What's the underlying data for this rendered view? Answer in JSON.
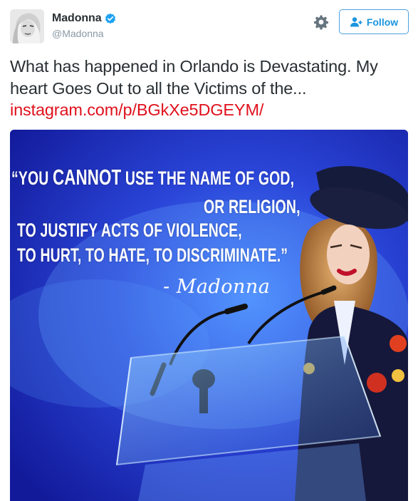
{
  "user": {
    "display_name": "Madonna",
    "handle": "@Madonna",
    "avatar_icon": "profile-photo",
    "verified_icon": "verified-badge-icon"
  },
  "actions": {
    "settings_icon": "gear-icon",
    "follow_label": "Follow",
    "follow_icon": "add-user-icon"
  },
  "tweet": {
    "text": "What has happened in Orlando is Devastating. My heart Goes Out to all the Victims of the...",
    "link_text": "instagram.com/p/BGkXe5DGEYM/"
  },
  "media": {
    "quote_line1_a": "“YOU ",
    "quote_line1_b": "CANNOT",
    "quote_line1_c": " USE THE NAME OF GOD,",
    "quote_line2": "OR RELIGION,",
    "quote_line3": "TO JUSTIFY ACTS OF VIOLENCE,",
    "quote_line4": "TO HURT, TO HATE, TO DISCRIMINATE.”",
    "attribution": "- Madonna"
  },
  "colors": {
    "link": "#e0101c",
    "follow_blue": "#1b95e0",
    "verified_blue": "#1da1f2",
    "text": "#292f33",
    "muted": "#8899a6",
    "media_bg": "#1620a8"
  }
}
